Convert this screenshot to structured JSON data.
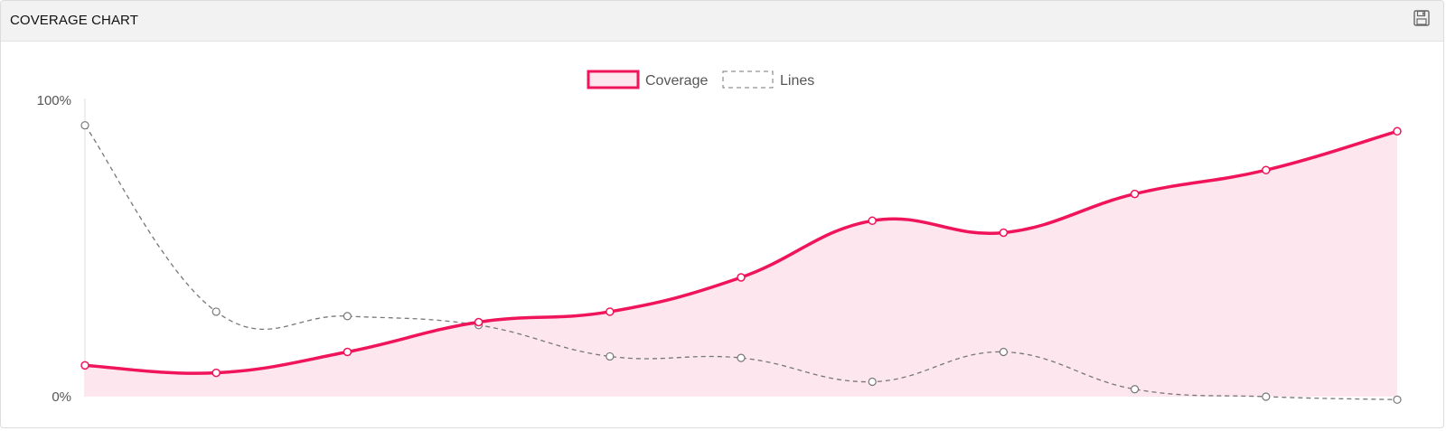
{
  "panel": {
    "title": "COVERAGE CHART",
    "save_icon": "floppy-disk-icon"
  },
  "colors": {
    "coverage_line": "#f0145a",
    "coverage_fill": "#fde6ee",
    "lines_stroke": "#777777",
    "axis": "#dddddd",
    "tick_text": "#555555"
  },
  "chart_data": {
    "type": "line",
    "y_ticks": [
      "100%",
      "0%"
    ],
    "ylim": [
      0,
      100
    ],
    "legend_position": "top-center",
    "grid": false,
    "series": [
      {
        "name": "Coverage",
        "style": "solid-filled",
        "values": [
          10.5,
          8,
          15,
          25,
          28.5,
          40,
          59,
          55,
          68,
          76,
          89
        ]
      },
      {
        "name": "Lines",
        "style": "dashed",
        "values": [
          91,
          28.5,
          27,
          24,
          13.5,
          13,
          5,
          15,
          2.5,
          0,
          -1
        ]
      }
    ]
  }
}
